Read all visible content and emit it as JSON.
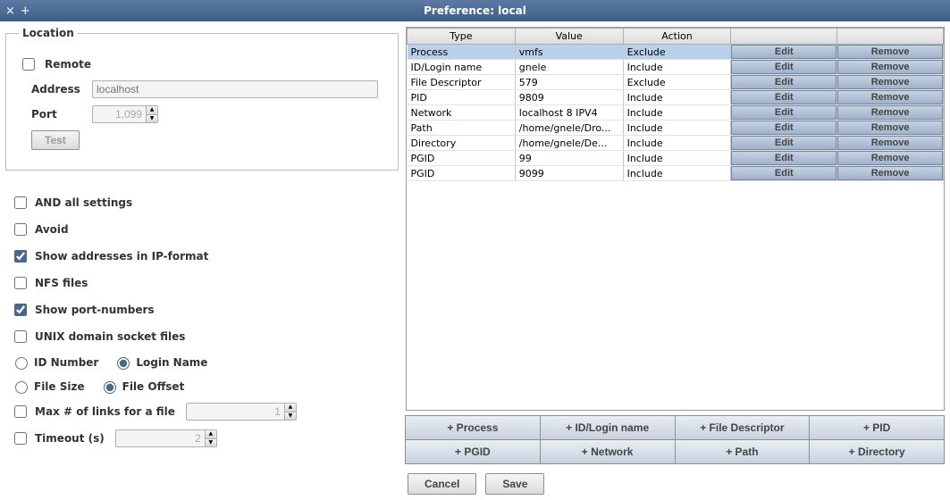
{
  "title": "Preference: local",
  "location": {
    "legend": "Location",
    "remote_label": "Remote",
    "remote_checked": false,
    "address_label": "Address",
    "address_placeholder": "localhost",
    "port_label": "Port",
    "port_value": "1,099",
    "test_label": "Test"
  },
  "options": {
    "and_all": {
      "label": "AND all settings",
      "checked": false
    },
    "avoid": {
      "label": "Avoid",
      "checked": false
    },
    "ipformat": {
      "label": "Show addresses in IP-format",
      "checked": true
    },
    "nfs": {
      "label": "NFS files",
      "checked": false
    },
    "ports": {
      "label": "Show port-numbers",
      "checked": true
    },
    "unix": {
      "label": "UNIX domain socket files",
      "checked": false
    },
    "id_radios": {
      "id_number": "ID Number",
      "login_name": "Login Name",
      "selected": "login_name"
    },
    "file_radios": {
      "file_size": "File Size",
      "file_offset": "File Offset",
      "selected": "file_offset"
    },
    "maxlinks": {
      "label": "Max # of links for a file",
      "value": "1",
      "checked": false
    },
    "timeout": {
      "label": "Timeout (s)",
      "value": "2",
      "checked": false
    }
  },
  "table": {
    "headers": [
      "Type",
      "Value",
      "Action",
      "",
      ""
    ],
    "edit_label": "Edit",
    "remove_label": "Remove",
    "rows": [
      {
        "type": "Process",
        "value": "vmfs",
        "action": "Exclude",
        "selected": true
      },
      {
        "type": "ID/Login name",
        "value": "gnele",
        "action": "Include"
      },
      {
        "type": "File Descriptor",
        "value": "579",
        "action": "Exclude"
      },
      {
        "type": "PID",
        "value": "9809",
        "action": "Include"
      },
      {
        "type": "Network",
        "value": "localhost 8 IPV4",
        "action": "Include"
      },
      {
        "type": "Path",
        "value": "/home/gnele/Dro...",
        "action": "Include"
      },
      {
        "type": "Directory",
        "value": "/home/gnele/De...",
        "action": "Include"
      },
      {
        "type": "PGID",
        "value": "99",
        "action": "Include"
      },
      {
        "type": "PGID",
        "value": "9099",
        "action": "Include"
      }
    ]
  },
  "add_buttons": [
    "+ Process",
    "+ ID/Login name",
    "+ File Descriptor",
    "+ PID",
    "+ PGID",
    "+ Network",
    "+ Path",
    "+ Directory"
  ],
  "dialog": {
    "cancel": "Cancel",
    "save": "Save"
  }
}
